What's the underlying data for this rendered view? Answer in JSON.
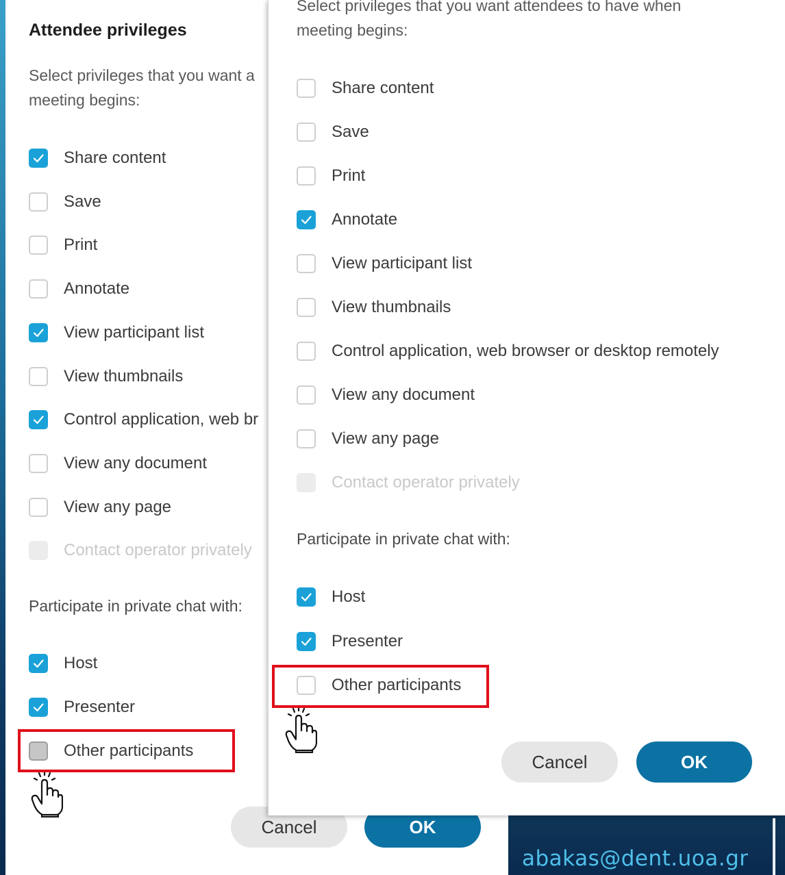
{
  "left_panel": {
    "title": "Attendee privileges",
    "description": "Select privileges that you want a\nmeeting begins:",
    "options": [
      {
        "label": "Share content",
        "checked": true
      },
      {
        "label": "Save",
        "checked": false
      },
      {
        "label": "Print",
        "checked": false
      },
      {
        "label": "Annotate",
        "checked": false
      },
      {
        "label": "View participant list",
        "checked": true
      },
      {
        "label": "View thumbnails",
        "checked": false
      },
      {
        "label": "Control application, web br",
        "checked": true
      },
      {
        "label": "View any document",
        "checked": false
      },
      {
        "label": "View any page",
        "checked": false
      },
      {
        "label": "Contact operator privately",
        "checked": false,
        "disabled": true
      }
    ],
    "chat_heading": "Participate in private chat with:",
    "chat_options": [
      {
        "label": "Host",
        "checked": true
      },
      {
        "label": "Presenter",
        "checked": true
      },
      {
        "label": "Other participants",
        "checked": false,
        "grey": true
      }
    ],
    "cancel_label": "Cancel",
    "ok_label": "OK"
  },
  "right_panel": {
    "description": "Select privileges that you want attendees to have when\nmeeting begins:",
    "options": [
      {
        "label": "Share content",
        "checked": false
      },
      {
        "label": "Save",
        "checked": false
      },
      {
        "label": "Print",
        "checked": false
      },
      {
        "label": "Annotate",
        "checked": true
      },
      {
        "label": "View participant list",
        "checked": false
      },
      {
        "label": "View thumbnails",
        "checked": false
      },
      {
        "label": "Control application, web browser or desktop remotely",
        "checked": false
      },
      {
        "label": "View any document",
        "checked": false
      },
      {
        "label": "View any page",
        "checked": false
      },
      {
        "label": "Contact operator privately",
        "checked": false,
        "disabled": true
      }
    ],
    "chat_heading": "Participate in private chat with:",
    "chat_options": [
      {
        "label": "Host",
        "checked": true
      },
      {
        "label": "Presenter",
        "checked": true
      },
      {
        "label": "Other participants",
        "checked": false
      }
    ],
    "cancel_label": "Cancel",
    "ok_label": "OK"
  },
  "footer": {
    "email": "abakas@dent.uoa.gr"
  },
  "colors": {
    "accent": "#1aa2d8",
    "ok_button": "#0b72a3",
    "highlight": "#e0101a"
  },
  "icons": {
    "pointer": "hand-pointer-icon",
    "check": "checkmark-icon"
  }
}
